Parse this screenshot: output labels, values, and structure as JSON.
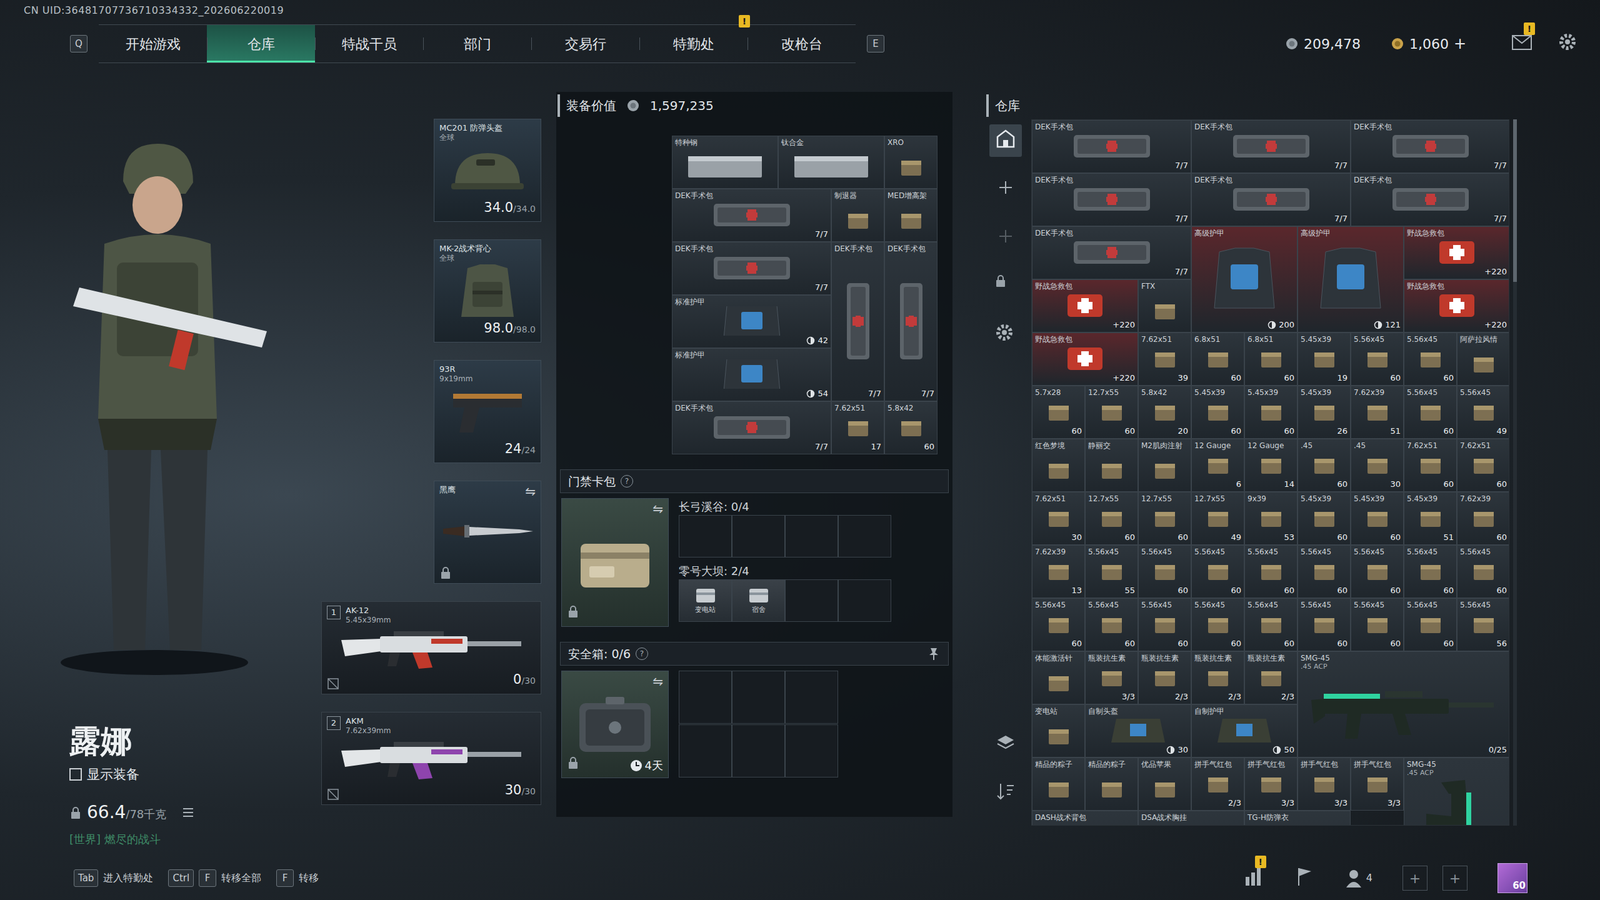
{
  "header": {
    "uid": "CN UID:36481707736710334332_202606220019"
  },
  "nav": {
    "prev_key": "Q",
    "next_key": "E",
    "alert_glyph": "!",
    "tabs": [
      {
        "label": "开始游戏",
        "selected": false,
        "alert": false
      },
      {
        "label": "仓库",
        "selected": true,
        "alert": false
      },
      {
        "label": "特战干员",
        "selected": false,
        "alert": false
      },
      {
        "label": "部门",
        "selected": false,
        "alert": false
      },
      {
        "label": "交易行",
        "selected": false,
        "alert": false
      },
      {
        "label": "特勤处",
        "selected": false,
        "alert": true
      },
      {
        "label": "改枪台",
        "selected": false,
        "alert": false
      }
    ]
  },
  "wallet": {
    "coins": "209,478",
    "premium": "1,060",
    "add": "+",
    "mail_alert": "!"
  },
  "character": {
    "name": "露娜",
    "show_gear": {
      "label": "显示装备",
      "checked": false
    },
    "weight": "66.4",
    "weight_max": "/78千克",
    "chat": "[世界] 燃尽的战斗"
  },
  "equipment": [
    {
      "kind": "helmet",
      "name": "MC201 防弹头盔",
      "sub": "全球",
      "value": "34.0",
      "max": "/34.0",
      "locked": false
    },
    {
      "kind": "vest",
      "name": "MK-2战术背心",
      "sub": "全球",
      "value": "98.0",
      "max": "/98.0",
      "locked": false
    },
    {
      "kind": "pistol",
      "name": "93R",
      "sub": "9x19mm",
      "value": "24",
      "max": "/24",
      "locked": false
    },
    {
      "kind": "knife",
      "name": "黑鹰",
      "swap": "⇋",
      "locked": true
    }
  ],
  "weapons": [
    {
      "slot": "1",
      "name": "AK-12",
      "sub": "5.45x39mm",
      "value": "0",
      "max": "/30",
      "color": "#c0392b"
    },
    {
      "slot": "2",
      "name": "AKM",
      "sub": "7.62x39mm",
      "value": "30",
      "max": "/30",
      "color": "#8e44ad"
    }
  ],
  "loadout": {
    "label": "装备价值",
    "value": "1,597,235",
    "backpack": [
      {
        "name": "特种钢",
        "kind": "plate"
      },
      {
        "name": "钛合金",
        "kind": "plate"
      },
      {
        "name": "XRO",
        "kind": "item"
      },
      {
        "name": "DEK手术包",
        "kind": "dek",
        "count": "7/7"
      },
      {
        "name": "制退器",
        "kind": "item"
      },
      {
        "name": "MED增高架",
        "kind": "item"
      },
      {
        "name": "DEK手术包",
        "kind": "dek",
        "count": "7/7"
      },
      {
        "name": "DEK手术包",
        "kind": "dek-v",
        "count": "7/7"
      },
      {
        "name": "DEK手术包",
        "kind": "dek-v",
        "count": "7/7"
      },
      {
        "name": "标准护甲",
        "kind": "armor-s",
        "count": "42"
      },
      {
        "name": "标准护甲",
        "kind": "armor-s",
        "count": "54"
      },
      {
        "name": "DEK手术包",
        "kind": "dek",
        "count": "7/7"
      },
      {
        "name": "7.62x51",
        "kind": "item",
        "count": "17"
      },
      {
        "name": "5.8x42",
        "kind": "item",
        "count": "60"
      }
    ]
  },
  "keycard": {
    "title": "门禁卡包",
    "help": "?",
    "swap": "⇋",
    "locked": true,
    "maps": [
      {
        "label": "长弓溪谷: 0/4",
        "cards": [
          {
            "filled": false
          },
          {
            "filled": false
          },
          {
            "filled": false
          },
          {
            "filled": false
          }
        ]
      },
      {
        "label": "零号大坝: 2/4",
        "cards": [
          {
            "filled": true,
            "name": "变电站"
          },
          {
            "filled": true,
            "name": "宿舍"
          },
          {
            "filled": false
          },
          {
            "filled": false
          }
        ]
      }
    ]
  },
  "safe": {
    "title": "安全箱: 0/6",
    "help": "?",
    "swap": "⇋",
    "locked": true,
    "timer": "4天",
    "slots": [
      {
        "filled": false
      },
      {
        "filled": false
      },
      {
        "filled": false
      },
      {
        "filled": false
      },
      {
        "filled": false
      },
      {
        "filled": false
      }
    ]
  },
  "stash": {
    "title": "仓库",
    "tools": [
      {
        "kind": "home",
        "selected": true,
        "disabled": false
      },
      {
        "kind": "add",
        "selected": false,
        "disabled": false
      },
      {
        "kind": "add",
        "selected": false,
        "disabled": true
      },
      {
        "kind": "lock",
        "selected": false,
        "disabled": false
      },
      {
        "kind": "gear",
        "selected": false,
        "disabled": false
      },
      {
        "kind": "layers",
        "selected": false,
        "disabled": false
      },
      {
        "kind": "sort",
        "selected": false,
        "disabled": false
      }
    ],
    "items": [
      {
        "name": "DEK手术包",
        "kind": "dek",
        "count": "7/7"
      },
      {
        "name": "DEK手术包",
        "kind": "dek",
        "count": "7/7"
      },
      {
        "name": "DEK手术包",
        "kind": "dek",
        "count": "7/7"
      },
      {
        "name": "DEK手术包",
        "kind": "dek",
        "count": "7/7"
      },
      {
        "name": "DEK手术包",
        "kind": "dek",
        "count": "7/7"
      },
      {
        "name": "DEK手术包",
        "kind": "dek",
        "count": "7/7"
      },
      {
        "name": "DEK手术包",
        "kind": "dek",
        "count": "7/7"
      },
      {
        "name": "高级护甲",
        "kind": "armor",
        "count": "200",
        "color": "#5a272c"
      },
      {
        "name": "高级护甲",
        "kind": "armor",
        "count": "121",
        "color": "#5a272c"
      },
      {
        "name": "野战急救包",
        "kind": "medkit",
        "count": "+220",
        "color": "#5a272c"
      },
      {
        "name": "野战急救包",
        "kind": "medkit",
        "count": "+220",
        "color": "#5a272c"
      },
      {
        "name": "FTX",
        "kind": "item"
      },
      {
        "name": "野战急救包",
        "kind": "medkit",
        "count": "+220",
        "color": "#5a272c"
      },
      {
        "name": "野战急救包",
        "kind": "medkit",
        "count": "+220",
        "color": "#5a272c"
      },
      {
        "name": "7.62x51",
        "kind": "item",
        "count": "39"
      },
      {
        "name": "6.8x51",
        "kind": "item",
        "count": "60"
      },
      {
        "name": "6.8x51",
        "kind": "item",
        "count": "60"
      },
      {
        "name": "5.45x39",
        "kind": "item",
        "count": "19"
      },
      {
        "name": "5.56x45",
        "kind": "item",
        "count": "60"
      },
      {
        "name": "5.56x45",
        "kind": "item",
        "count": "60"
      },
      {
        "name": "阿萨拉风情",
        "kind": "item"
      },
      {
        "name": "5.7x28",
        "kind": "item",
        "count": "60"
      },
      {
        "name": "12.7x55",
        "kind": "item",
        "count": "60"
      },
      {
        "name": "5.8x42",
        "kind": "item",
        "count": "20"
      },
      {
        "name": "5.45x39",
        "kind": "item",
        "count": "60"
      },
      {
        "name": "5.45x39",
        "kind": "item",
        "count": "60"
      },
      {
        "name": "5.45x39",
        "kind": "item",
        "count": "26"
      },
      {
        "name": "7.62x39",
        "kind": "item",
        "count": "51"
      },
      {
        "name": "5.56x45",
        "kind": "item",
        "count": "60"
      },
      {
        "name": "5.56x45",
        "kind": "item",
        "count": "49"
      },
      {
        "name": "红色梦境",
        "kind": "item"
      },
      {
        "name": "静丽交",
        "kind": "item"
      },
      {
        "name": "M2肌肉注射",
        "kind": "item"
      },
      {
        "name": "12 Gauge",
        "kind": "item",
        "count": "6"
      },
      {
        "name": "12 Gauge",
        "kind": "item",
        "count": "14"
      },
      {
        "name": ".45",
        "kind": "item",
        "count": "60"
      },
      {
        "name": ".45",
        "kind": "item",
        "count": "30"
      },
      {
        "name": "7.62x51",
        "kind": "item",
        "count": "60"
      },
      {
        "name": "7.62x51",
        "kind": "item",
        "count": "60"
      },
      {
        "name": "7.62x51",
        "kind": "item",
        "count": "30"
      },
      {
        "name": "12.7x55",
        "kind": "item",
        "count": "60"
      },
      {
        "name": "12.7x55",
        "kind": "item",
        "count": "60"
      },
      {
        "name": "12.7x55",
        "kind": "item",
        "count": "49"
      },
      {
        "name": "9x39",
        "kind": "item",
        "count": "53"
      },
      {
        "name": "5.45x39",
        "kind": "item",
        "count": "60"
      },
      {
        "name": "5.45x39",
        "kind": "item",
        "count": "60"
      },
      {
        "name": "5.45x39",
        "kind": "item",
        "count": "51"
      },
      {
        "name": "7.62x39",
        "kind": "item",
        "count": "60"
      },
      {
        "name": "7.62x39",
        "kind": "item",
        "count": "13"
      },
      {
        "name": "5.56x45",
        "kind": "item",
        "count": "55"
      },
      {
        "name": "5.56x45",
        "kind": "item",
        "count": "60"
      },
      {
        "name": "5.56x45",
        "kind": "item",
        "count": "60"
      },
      {
        "name": "5.56x45",
        "kind": "item",
        "count": "60"
      },
      {
        "name": "5.56x45",
        "kind": "item",
        "count": "60"
      },
      {
        "name": "5.56x45",
        "kind": "item",
        "count": "60"
      },
      {
        "name": "5.56x45",
        "kind": "item",
        "count": "60"
      },
      {
        "name": "5.56x45",
        "kind": "item",
        "count": "60"
      },
      {
        "name": "5.56x45",
        "kind": "item",
        "count": "60"
      },
      {
        "name": "5.56x45",
        "kind": "item",
        "count": "60"
      },
      {
        "name": "5.56x45",
        "kind": "item",
        "count": "60"
      },
      {
        "name": "5.56x45",
        "kind": "item",
        "count": "60"
      },
      {
        "name": "5.56x45",
        "kind": "item",
        "count": "60"
      },
      {
        "name": "5.56x45",
        "kind": "item",
        "count": "60"
      },
      {
        "name": "5.56x45",
        "kind": "item",
        "count": "60"
      },
      {
        "name": "5.56x45",
        "kind": "item",
        "count": "60"
      },
      {
        "name": "5.56x45",
        "kind": "item",
        "count": "56"
      },
      {
        "name": "体能激活针",
        "kind": "item"
      },
      {
        "name": "瓶装抗生素",
        "kind": "item",
        "count": "3/3"
      },
      {
        "name": "瓶装抗生素",
        "kind": "item",
        "count": "2/3"
      },
      {
        "name": "瓶装抗生素",
        "kind": "item",
        "count": "2/3"
      },
      {
        "name": "瓶装抗生素",
        "kind": "item",
        "count": "2/3"
      },
      {
        "name": "SMG-45",
        "sub": ".45 ACP",
        "kind": "gun",
        "count": "0/25"
      },
      {
        "name": "变电站",
        "kind": "item"
      },
      {
        "name": "自制头盔",
        "kind": "gear",
        "count": "30"
      },
      {
        "name": "自制护甲",
        "kind": "gear",
        "count": "50"
      },
      {
        "name": "精品的粽子",
        "kind": "item"
      },
      {
        "name": "精品的粽子",
        "kind": "item"
      },
      {
        "name": "优品苹果",
        "kind": "item"
      },
      {
        "name": "拼手气红包",
        "kind": "item",
        "count": "2/3"
      },
      {
        "name": "拼手气红包",
        "kind": "item",
        "count": "3/3"
      },
      {
        "name": "拼手气红包",
        "kind": "item",
        "count": "3/3"
      },
      {
        "name": "拼手气红包",
        "kind": "item",
        "count": "3/3"
      },
      {
        "name": "SMG-45",
        "sub": ".45 ACP",
        "kind": "gun-v"
      },
      {
        "name": "DASH战术背包",
        "kind": "bag"
      },
      {
        "name": "DSA战术胸挂",
        "kind": "bag"
      },
      {
        "name": "TG-H防弹衣",
        "kind": "bag"
      }
    ]
  },
  "footer": {
    "actions": [
      {
        "keys": [
          "Tab"
        ],
        "label": "进入特勤处"
      },
      {
        "keys": [
          "Ctrl",
          "F"
        ],
        "label": "转移全部"
      },
      {
        "keys": [
          "F"
        ],
        "label": "转移"
      }
    ],
    "social": {
      "alert": "!",
      "friends": "4",
      "slots": [
        "+",
        "+"
      ],
      "level": "60"
    }
  }
}
